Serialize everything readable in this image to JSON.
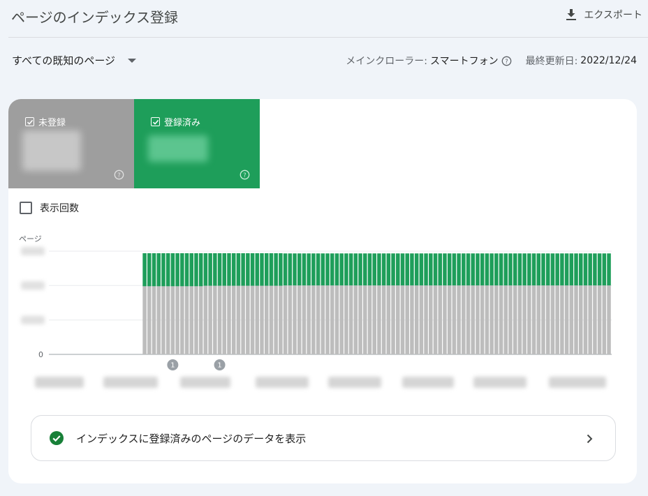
{
  "header": {
    "title": "ページのインデックス登録",
    "export_label": "エクスポート"
  },
  "filter": {
    "selected": "すべての既知のページ"
  },
  "meta": {
    "crawler_label": "メインクローラー:",
    "crawler_value": "スマートフォン",
    "updated_label": "最終更新日:",
    "updated_value": "2022/12/24"
  },
  "tiles": {
    "unregistered": {
      "label": "未登録",
      "checked": true,
      "color": "#9e9e9e"
    },
    "registered": {
      "label": "登録済み",
      "checked": true,
      "color": "#1e9e5a"
    }
  },
  "impressions": {
    "label": "表示回数",
    "checked": false
  },
  "chart_data": {
    "type": "bar",
    "stacked": true,
    "ylabel": "ページ",
    "y_tick_zero": "0",
    "series": [
      {
        "key": "not_indexed",
        "color": "#bdbdbd",
        "values": [
          0,
          0,
          0,
          0,
          0,
          0,
          0,
          0,
          0,
          0,
          0,
          0,
          0,
          0,
          0,
          0,
          0,
          0,
          0,
          0,
          0.66,
          0.66,
          0.66,
          0.66,
          0.66,
          0.66,
          0.66,
          0.66,
          0.66,
          0.66,
          0.66,
          0.66,
          0.66,
          0.665,
          0.665,
          0.665,
          0.665,
          0.665,
          0.665,
          0.665,
          0.665,
          0.665,
          0.665,
          0.665,
          0.665,
          0.665,
          0.665,
          0.665,
          0.665,
          0.665,
          0.668,
          0.668,
          0.668,
          0.668,
          0.668,
          0.668,
          0.668,
          0.668,
          0.668,
          0.668,
          0.668,
          0.668,
          0.668,
          0.668,
          0.668,
          0.668,
          0.668,
          0.668,
          0.668,
          0.668,
          0.668,
          0.668,
          0.668,
          0.668,
          0.668,
          0.668,
          0.668,
          0.668,
          0.668,
          0.668,
          0.668,
          0.668,
          0.668,
          0.668,
          0.668,
          0.668,
          0.668,
          0.668,
          0.668,
          0.668,
          0.668,
          0.668,
          0.668,
          0.668,
          0.668,
          0.668,
          0.668,
          0.668,
          0.668,
          0.668,
          0.668,
          0.668,
          0.668,
          0.668,
          0.668,
          0.668,
          0.668,
          0.668,
          0.668,
          0.668,
          0.668,
          0.668,
          0.668,
          0.668,
          0.668,
          0.668,
          0.668,
          0.668,
          0.668,
          0.668
        ]
      },
      {
        "key": "indexed",
        "color": "#1e9e5a",
        "values": [
          0,
          0,
          0,
          0,
          0,
          0,
          0,
          0,
          0,
          0,
          0,
          0,
          0,
          0,
          0,
          0,
          0,
          0,
          0,
          0,
          0.32,
          0.32,
          0.32,
          0.32,
          0.32,
          0.32,
          0.32,
          0.32,
          0.32,
          0.32,
          0.32,
          0.32,
          0.32,
          0.315,
          0.315,
          0.315,
          0.315,
          0.315,
          0.315,
          0.315,
          0.315,
          0.315,
          0.315,
          0.315,
          0.315,
          0.315,
          0.315,
          0.315,
          0.315,
          0.315,
          0.31,
          0.31,
          0.31,
          0.31,
          0.31,
          0.31,
          0.31,
          0.31,
          0.31,
          0.31,
          0.31,
          0.31,
          0.31,
          0.31,
          0.31,
          0.31,
          0.31,
          0.31,
          0.31,
          0.31,
          0.31,
          0.31,
          0.31,
          0.31,
          0.31,
          0.31,
          0.31,
          0.31,
          0.31,
          0.31,
          0.31,
          0.31,
          0.31,
          0.31,
          0.31,
          0.31,
          0.31,
          0.31,
          0.31,
          0.31,
          0.31,
          0.31,
          0.31,
          0.31,
          0.31,
          0.31,
          0.31,
          0.31,
          0.31,
          0.31,
          0.31,
          0.31,
          0.31,
          0.31,
          0.31,
          0.31,
          0.31,
          0.31,
          0.31,
          0.31,
          0.31,
          0.31,
          0.31,
          0.31,
          0.31,
          0.31,
          0.31,
          0.31,
          0.31,
          0.31
        ]
      }
    ],
    "annotations": [
      {
        "text": "1",
        "bar_index": 26
      },
      {
        "text": "1",
        "bar_index": 36
      }
    ]
  },
  "view_data": {
    "label": "インデックスに登録済みのページのデータを表示"
  }
}
